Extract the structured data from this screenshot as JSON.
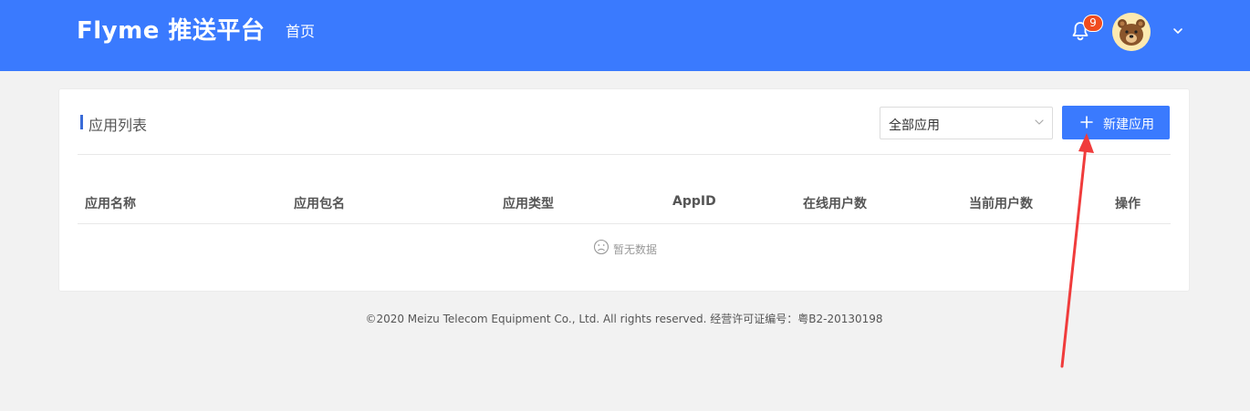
{
  "header": {
    "logo_text": "Flyme 推送平台",
    "nav_home": "首页",
    "notification_count": "9",
    "colors": {
      "bar": "#3a7afe",
      "badge": "#f04b1e"
    }
  },
  "card": {
    "title": "应用列表",
    "filter": {
      "selected": "全部应用"
    },
    "new_button": "新建应用",
    "table": {
      "columns": [
        "应用名称",
        "应用包名",
        "应用类型",
        "AppID",
        "在线用户数",
        "当前用户数",
        "操作"
      ],
      "empty_text": "暂无数据"
    }
  },
  "footer": {
    "text": "©2020 Meizu Telecom Equipment Co., Ltd. All rights reserved. 经营许可证编号：粤B2-20130198"
  },
  "icons": {
    "bell": "bell-icon",
    "avatar": "bear-avatar",
    "caret": "chevron-down-icon",
    "plus": "plus-icon",
    "empty": "sad-face-icon"
  }
}
